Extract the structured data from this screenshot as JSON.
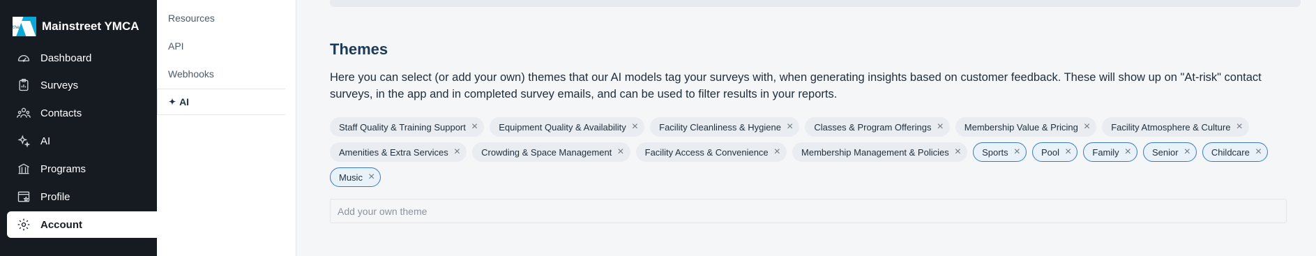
{
  "brand": {
    "name": "Mainstreet YMCA"
  },
  "sidebar": {
    "items": [
      {
        "label": "Dashboard",
        "icon": "dashboard-icon"
      },
      {
        "label": "Surveys",
        "icon": "clipboard-icon"
      },
      {
        "label": "Contacts",
        "icon": "contacts-icon"
      },
      {
        "label": "AI",
        "icon": "sparkle-icon"
      },
      {
        "label": "Programs",
        "icon": "building-icon"
      },
      {
        "label": "Profile",
        "icon": "profile-card-icon"
      },
      {
        "label": "Account",
        "icon": "gear-icon",
        "active": true
      }
    ]
  },
  "subnav": {
    "items": [
      {
        "label": "Resources"
      },
      {
        "label": "API"
      },
      {
        "label": "Webhooks"
      },
      {
        "label": "AI",
        "active": true,
        "icon": "sparkle-icon"
      }
    ]
  },
  "themes": {
    "title": "Themes",
    "description": "Here you can select (or add your own) themes that our AI models tag your surveys with, when generating insights based on customer feedback. These will show up on \"At-risk\" contact surveys, in the app and in completed survey emails, and can be used to filter results in your reports.",
    "tags": [
      {
        "label": "Staff Quality & Training Support",
        "custom": false
      },
      {
        "label": "Equipment Quality & Availability",
        "custom": false
      },
      {
        "label": "Facility Cleanliness & Hygiene",
        "custom": false
      },
      {
        "label": "Classes & Program Offerings",
        "custom": false
      },
      {
        "label": "Membership Value & Pricing",
        "custom": false
      },
      {
        "label": "Facility Atmosphere & Culture",
        "custom": false
      },
      {
        "label": "Amenities & Extra Services",
        "custom": false
      },
      {
        "label": "Crowding & Space Management",
        "custom": false
      },
      {
        "label": "Facility Access & Convenience",
        "custom": false
      },
      {
        "label": "Membership Management & Policies",
        "custom": false
      },
      {
        "label": "Sports",
        "custom": true
      },
      {
        "label": "Pool",
        "custom": true
      },
      {
        "label": "Family",
        "custom": true
      },
      {
        "label": "Senior",
        "custom": true
      },
      {
        "label": "Childcare",
        "custom": true
      },
      {
        "label": "Music",
        "custom": true
      }
    ],
    "input_placeholder": "Add your own theme",
    "input_value": ""
  },
  "colors": {
    "sidebar_bg": "#161b22",
    "title": "#1b3a57",
    "custom_tag_border": "#3a7bbf",
    "default_tag_bg": "#e9edf1"
  }
}
